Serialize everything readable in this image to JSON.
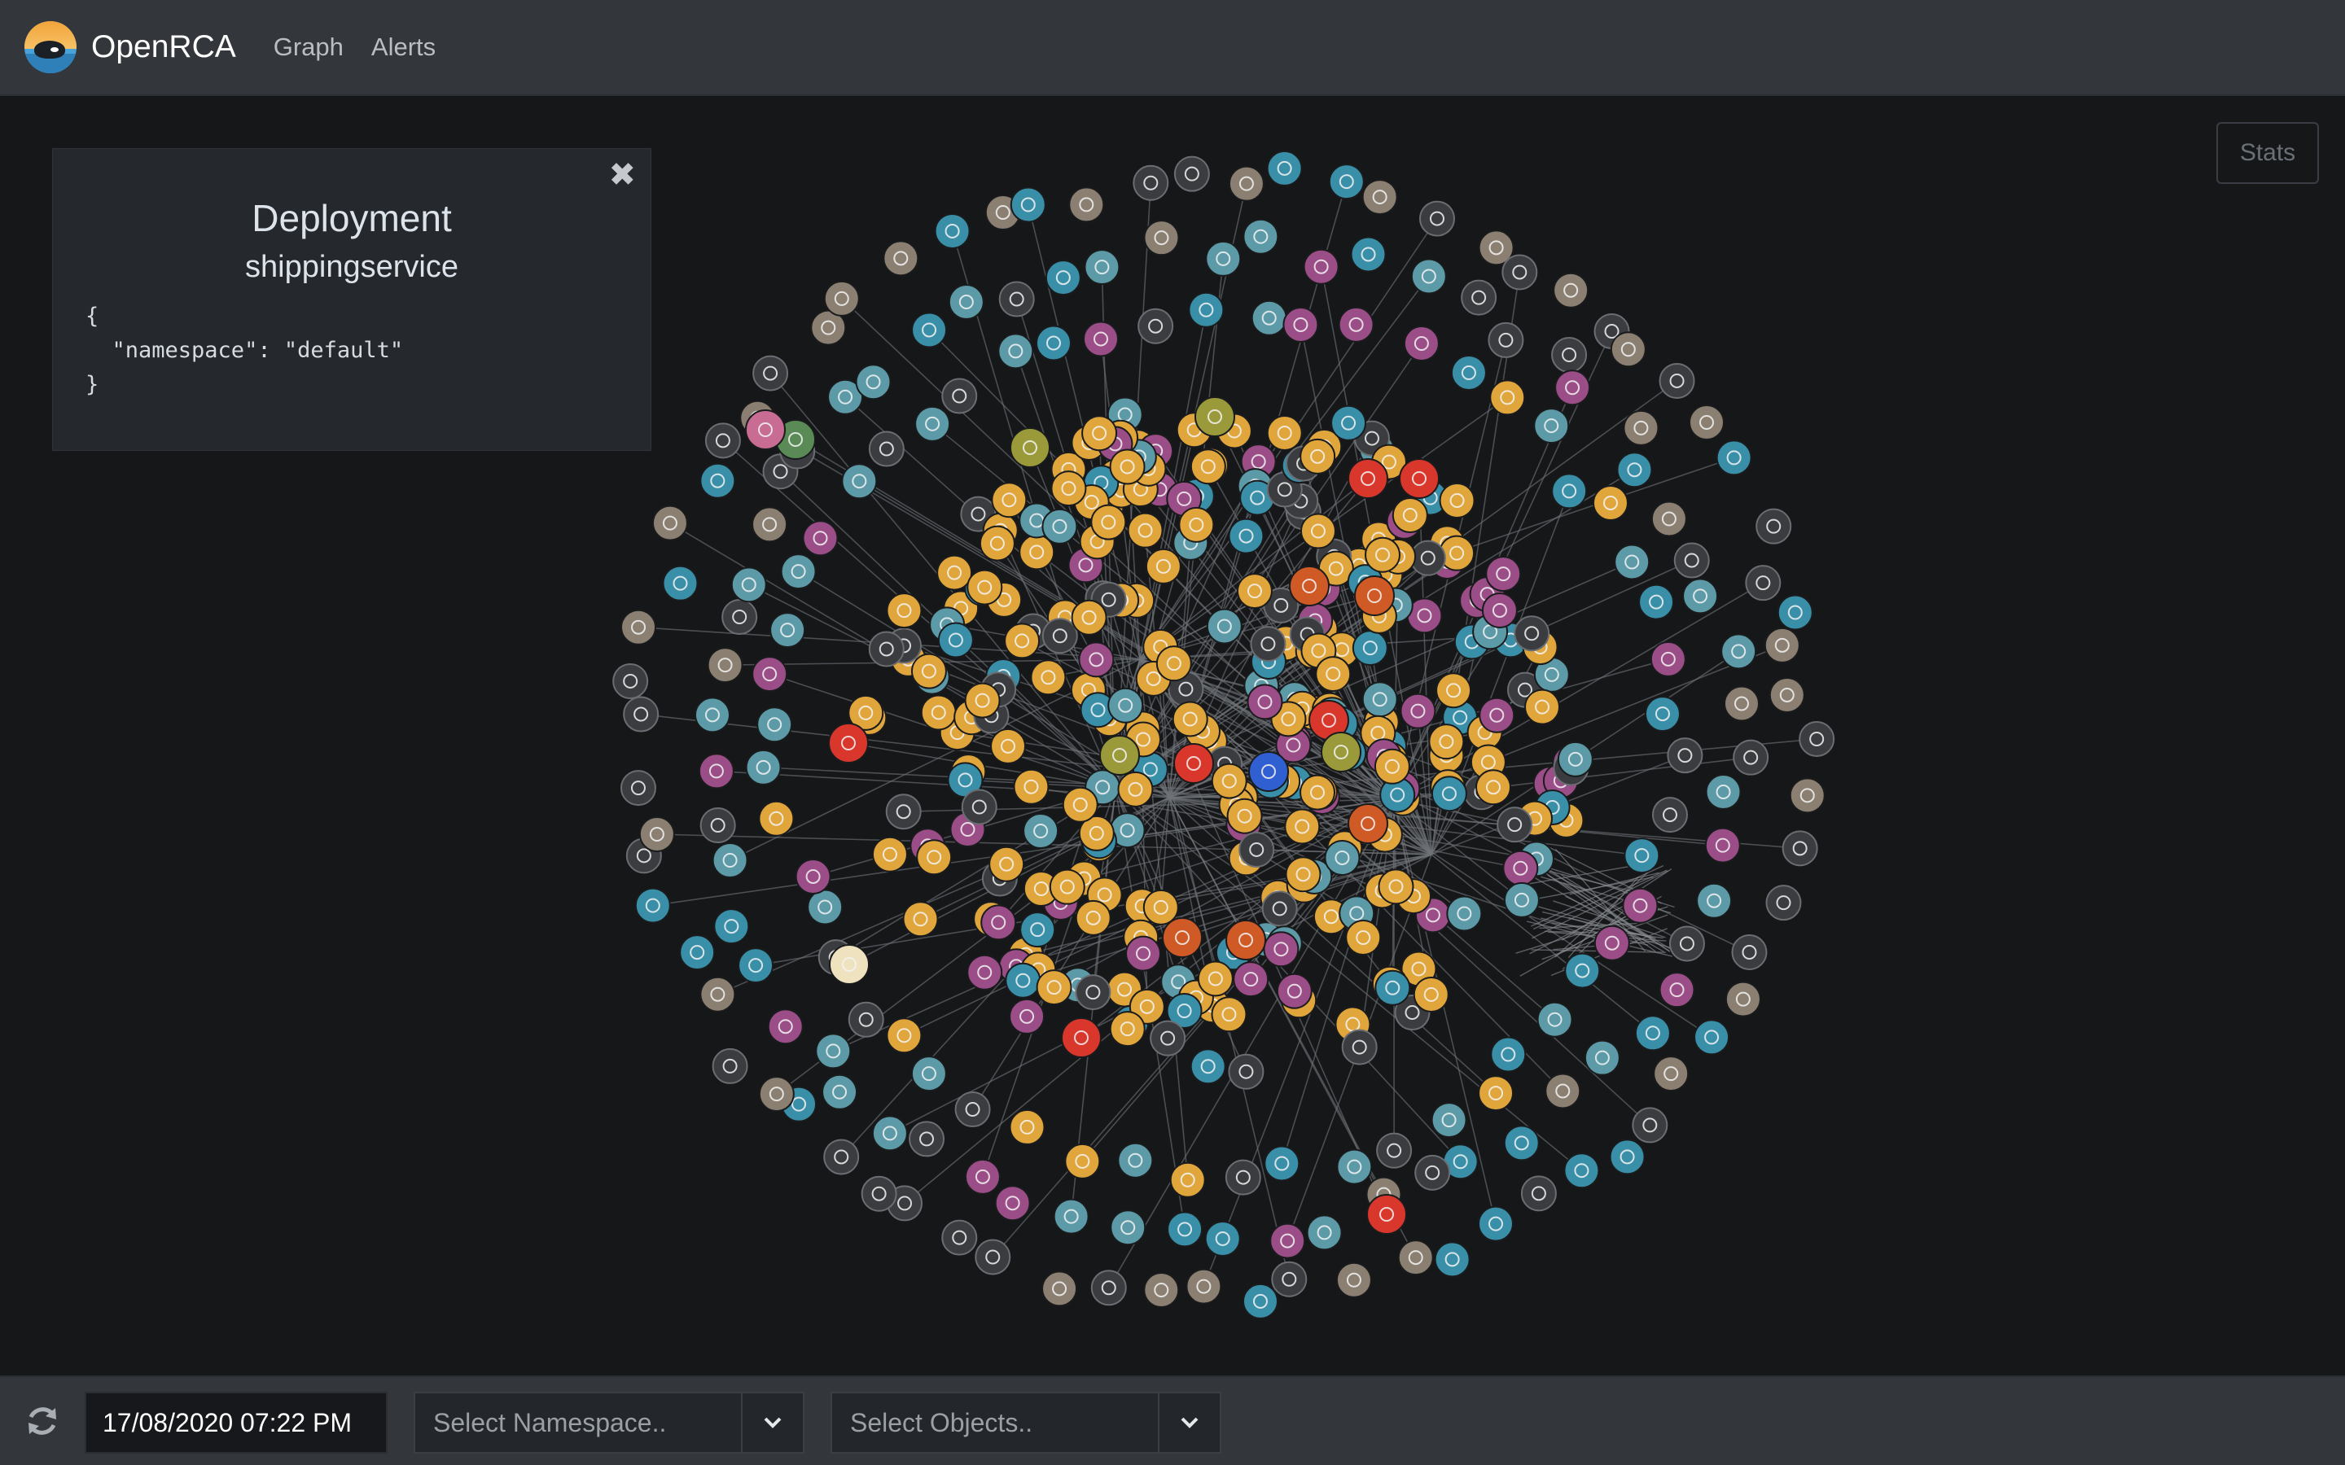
{
  "app": {
    "name": "OpenRCA"
  },
  "nav": {
    "links": [
      "Graph",
      "Alerts"
    ]
  },
  "info_panel": {
    "title": "Deployment",
    "subtitle": "shippingservice",
    "json_lines": [
      "{",
      "  \"namespace\": \"default\"",
      "}"
    ]
  },
  "stats_button": "Stats",
  "bottom_bar": {
    "datetime": "17/08/2020 07:22 PM",
    "namespace_placeholder": "Select Namespace..",
    "objects_placeholder": "Select Objects.."
  },
  "colors": {
    "accent_orange": "#e0a53b",
    "teal": "#3a8fa8",
    "slate_teal": "#5b9aa6",
    "magenta": "#9a4d86",
    "beige": "#8b7f71",
    "dark_gray": "#3a3c3f",
    "red_alert": "#d9362c",
    "olive": "#9a9a3a",
    "orange_red": "#d05a25",
    "green": "#5a8a55"
  },
  "icons": [
    "logo-icon",
    "close-icon",
    "refresh-icon",
    "chevron-down-icon"
  ]
}
